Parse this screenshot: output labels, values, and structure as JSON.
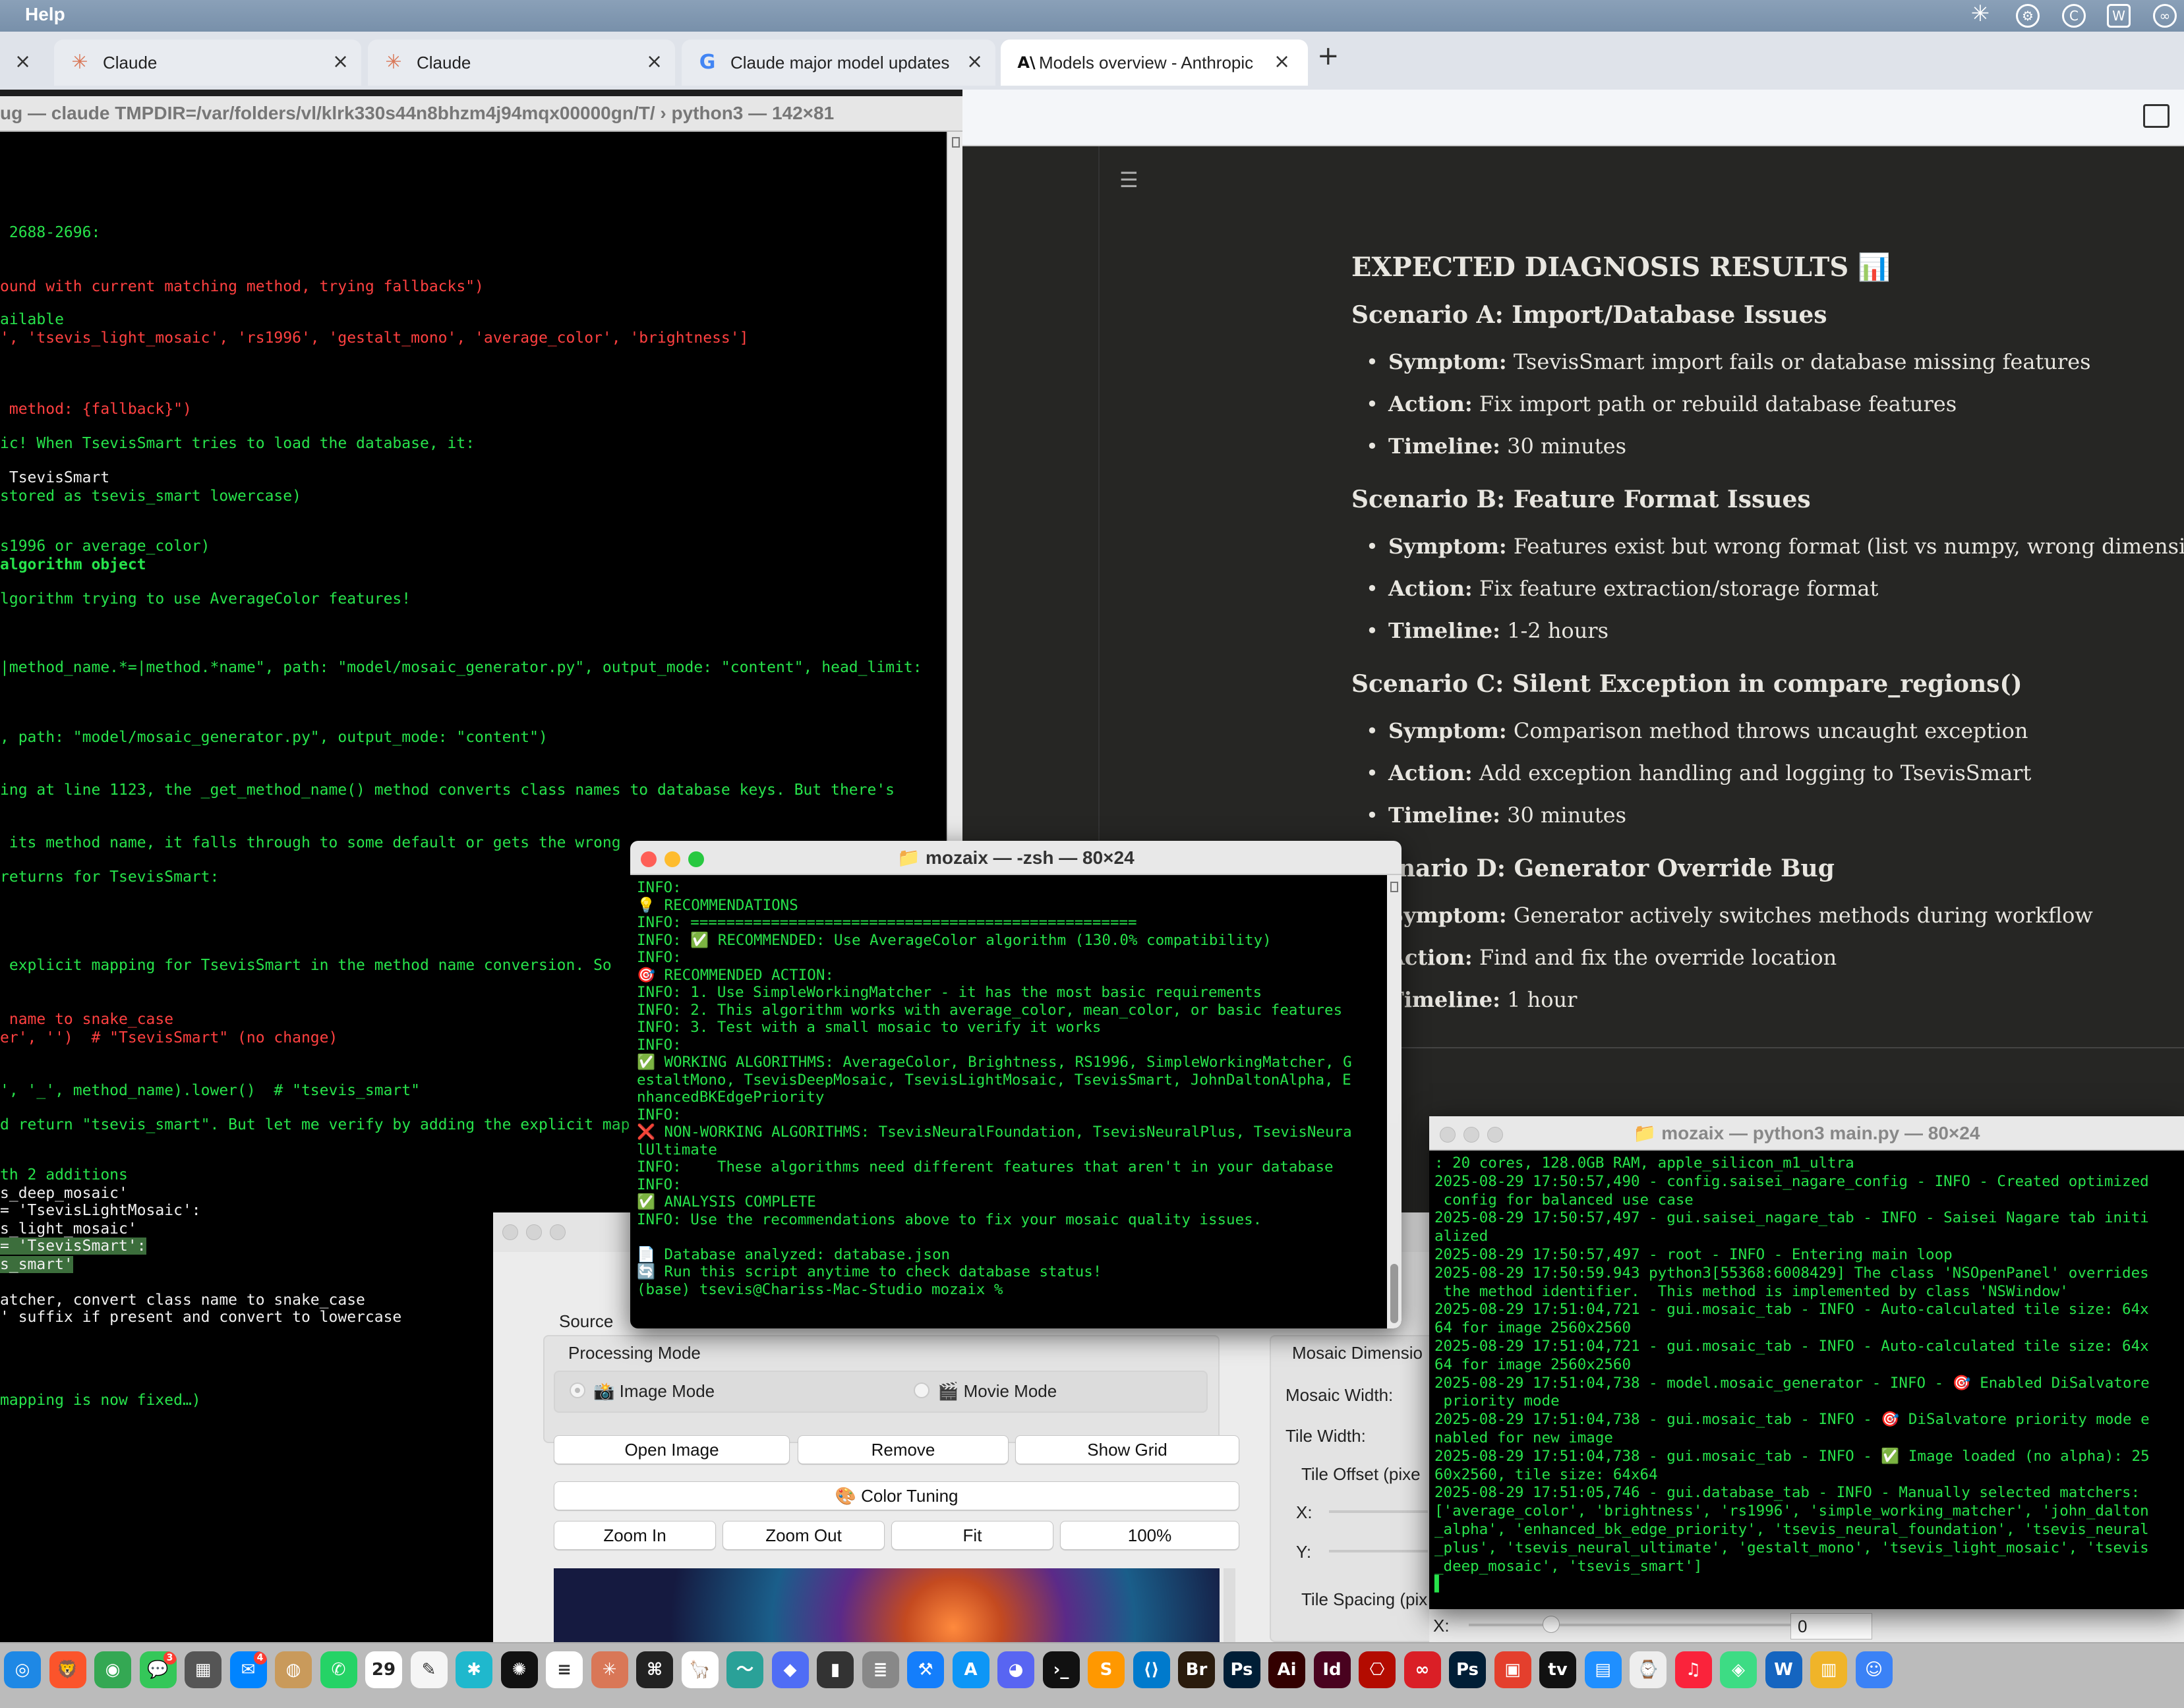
{
  "menubar": {
    "menu": "Help",
    "status_icons": [
      "claude-status-icon",
      "chatgpt-status-icon",
      "sync-status-icon",
      "w-status-icon",
      "creative-cloud-icon"
    ]
  },
  "browser": {
    "tabs": [
      {
        "label": "Claude",
        "icon": "claude-favicon"
      },
      {
        "label": "Claude",
        "icon": "claude-favicon"
      },
      {
        "label": "Claude major model updates",
        "icon": "google-favicon"
      },
      {
        "label": "Models overview - Anthropic",
        "icon": "anthropic-favicon"
      }
    ],
    "new_tab": "+",
    "close_glyph": "×"
  },
  "doc": {
    "heading": "EXPECTED DIAGNOSIS RESULTS 📊",
    "scenarios": [
      {
        "title": "Scenario A: Import/Database Issues",
        "items": [
          {
            "label": "Symptom:",
            "text": " TsevisSmart import fails or database missing features"
          },
          {
            "label": "Action:",
            "text": " Fix import path or rebuild database features"
          },
          {
            "label": "Timeline:",
            "text": " 30 minutes"
          }
        ]
      },
      {
        "title": "Scenario B: Feature Format Issues",
        "items": [
          {
            "label": "Symptom:",
            "text": " Features exist but wrong format (list vs numpy, wrong dimensions)"
          },
          {
            "label": "Action:",
            "text": " Fix feature extraction/storage format"
          },
          {
            "label": "Timeline:",
            "text": " 1-2 hours"
          }
        ]
      },
      {
        "title": "Scenario C: Silent Exception in compare_regions()",
        "items": [
          {
            "label": "Symptom:",
            "text": " Comparison method throws uncaught exception"
          },
          {
            "label": "Action:",
            "text": " Add exception handling and logging to TsevisSmart"
          },
          {
            "label": "Timeline:",
            "text": " 30 minutes"
          }
        ]
      },
      {
        "title": "Scenario D: Generator Override Bug",
        "items": [
          {
            "label": "Symptom:",
            "text": " Generator actively switches methods during workflow"
          },
          {
            "label": "Action:",
            "text": " Find and fix the override location"
          },
          {
            "label": "Timeline:",
            "text": " 1 hour"
          }
        ]
      }
    ]
  },
  "term_main": {
    "title": "ug — claude TMPDIR=/var/folders/vl/klrk330s44n8bhzm4j94mqx00000gn/T/ › python3 — 142×81",
    "lines": [
      {
        "text": " 2688-2696:",
        "color": "green"
      },
      {
        "text": "ound with current matching method, trying fallbacks\")",
        "color": "red"
      },
      {
        "text": "ailable",
        "color": "green"
      },
      {
        "text": "', 'tsevis_light_mosaic', 'rs1996', 'gestalt_mono', 'average_color', 'brightness']",
        "color": "red"
      },
      {
        "text": " method: {fallback}\")",
        "color": "red"
      },
      {
        "text": "ic! When TsevisSmart tries to load the database, it:",
        "color": "green",
        "bold_prefix": true
      },
      {
        "text": " TsevisSmart",
        "color": "white"
      },
      {
        "text": "stored as tsevis_smart lowercase)",
        "color": "green"
      },
      {
        "text": "s1996 or average_color)",
        "color": "green"
      },
      {
        "text": "algorithm object",
        "color": "green",
        "bold": true
      },
      {
        "text": "lgorithm trying to use AverageColor features!",
        "color": "green"
      },
      {
        "text": "|method_name.*=|method.*name\", path: \"model/mosaic_generator.py\", output_mode: \"content\", head_limit:",
        "color": "green"
      },
      {
        "text": ", path: \"model/mosaic_generator.py\", output_mode: \"content\")",
        "color": "green"
      },
      {
        "text": "ing at line 1123, the _get_method_name() method converts class names to database keys. But there's",
        "color": "green"
      },
      {
        "text": " its method name, it falls through to some default or gets the wrong",
        "color": "green"
      },
      {
        "text": "returns for TsevisSmart:",
        "color": "green"
      },
      {
        "text": " explicit mapping for TsevisSmart in the method name conversion. So",
        "color": "green"
      },
      {
        "text": " name to snake_case",
        "color": "red"
      },
      {
        "text": "er', '')  # \"TsevisSmart\" (no change)",
        "color": "red"
      },
      {
        "text": "', '_', method_name).lower()  # \"tsevis_smart\"",
        "color": "green"
      },
      {
        "text": "d return \"tsevis_smart\". But let me verify by adding the explicit map",
        "color": "green"
      },
      {
        "text": "th 2 additions",
        "color": "green"
      },
      {
        "text": "s_deep_mosaic'",
        "color": "white"
      },
      {
        "text": "= 'TsevisLightMosaic':",
        "color": "white"
      },
      {
        "text": "s_light_mosaic'",
        "color": "white"
      },
      {
        "text": "= 'TsevisSmart':",
        "color": "white",
        "highlight": true
      },
      {
        "text": "s_smart'",
        "color": "white",
        "highlight": true
      },
      {
        "text": "atcher, convert class name to snake_case",
        "color": "white"
      },
      {
        "text": "' suffix if present and convert to lowercase",
        "color": "white"
      },
      {
        "text": "mapping is now fixed…)",
        "color": "green"
      }
    ]
  },
  "term_zsh": {
    "title": "📁 mozaix — -zsh — 80×24",
    "lines": [
      {
        "text": "INFO:",
        "color": "green"
      },
      {
        "text": "💡 RECOMMENDATIONS",
        "color": "green"
      },
      {
        "text": "INFO: ==================================================",
        "color": "green"
      },
      {
        "text": "INFO: ✅ RECOMMENDED: Use AverageColor algorithm (130.0% compatibility)",
        "color": "green"
      },
      {
        "text": "INFO:",
        "color": "green"
      },
      {
        "text": "🎯 RECOMMENDED ACTION:",
        "color": "green"
      },
      {
        "text": "INFO: 1. Use SimpleWorkingMatcher - it has the most basic requirements",
        "color": "green"
      },
      {
        "text": "INFO: 2. This algorithm works with average_color, mean_color, or basic features",
        "color": "green"
      },
      {
        "text": "INFO: 3. Test with a small mosaic to verify it works",
        "color": "green"
      },
      {
        "text": "INFO:",
        "color": "green"
      },
      {
        "text": "✅ WORKING ALGORITHMS: AverageColor, Brightness, RS1996, SimpleWorkingMatcher, G",
        "color": "green"
      },
      {
        "text": "estaltMono, TsevisDeepMosaic, TsevisLightMosaic, TsevisSmart, JohnDaltonAlpha, E",
        "color": "green"
      },
      {
        "text": "nhancedBKEdgePriority",
        "color": "green"
      },
      {
        "text": "INFO:",
        "color": "green"
      },
      {
        "text": "❌ NON-WORKING ALGORITHMS: TsevisNeuralFoundation, TsevisNeuralPlus, TsevisNeura",
        "color": "green"
      },
      {
        "text": "lUltimate",
        "color": "green"
      },
      {
        "text": "INFO:    These algorithms need different features that aren't in your database",
        "color": "green"
      },
      {
        "text": "INFO:",
        "color": "green"
      },
      {
        "text": "✅ ANALYSIS COMPLETE",
        "color": "green"
      },
      {
        "text": "INFO: Use the recommendations above to fix your mosaic quality issues.",
        "color": "green"
      },
      {
        "text": "",
        "color": "green"
      },
      {
        "text": "📄 Database analyzed: database.json",
        "color": "green"
      },
      {
        "text": "🔄 Run this script anytime to check database status!",
        "color": "green"
      },
      {
        "text": "(base) tsevis@Chariss-Mac-Studio mozaix %",
        "color": "green"
      }
    ]
  },
  "term_py": {
    "title": "📁 mozaix — python3 main.py — 80×24",
    "lines": [
      ": 20 cores, 128.0GB RAM, apple_silicon_m1_ultra",
      "2025-08-29 17:50:57,490 - config.saisei_nagare_config - INFO - Created optimized",
      " config for balanced use case",
      "2025-08-29 17:50:57,497 - gui.saisei_nagare_tab - INFO - Saisei Nagare tab initi",
      "alized",
      "2025-08-29 17:50:57,497 - root - INFO - Entering main loop",
      "2025-08-29 17:50:59.943 python3[55368:6008429] The class 'NSOpenPanel' overrides",
      " the method identifier.  This method is implemented by class 'NSWindow'",
      "2025-08-29 17:51:04,721 - gui.mosaic_tab - INFO - Auto-calculated tile size: 64x",
      "64 for image 2560x2560",
      "2025-08-29 17:51:04,721 - gui.mosaic_tab - INFO - Auto-calculated tile size: 64x",
      "64 for image 2560x2560",
      "2025-08-29 17:51:04,738 - model.mosaic_generator - INFO - 🎯 Enabled DiSalvatore",
      " priority mode",
      "2025-08-29 17:51:04,738 - gui.mosaic_tab - INFO - 🎯 DiSalvatore priority mode e",
      "nabled for new image",
      "2025-08-29 17:51:04,738 - gui.mosaic_tab - INFO - ✅ Image loaded (no alpha): 25",
      "60x2560, tile size: 64x64",
      "2025-08-29 17:51:05,746 - gui.database_tab - INFO - Manually selected matchers:",
      "['average_color', 'brightness', 'rs1996', 'simple_working_matcher', 'john_dalton",
      "_alpha', 'enhanced_bk_edge_priority', 'tsevis_neural_foundation', 'tsevis_neural",
      "_plus', 'tsevis_neural_ultimate', 'gestalt_mono', 'tsevis_light_mosaic', 'tsevis",
      "_deep_mosaic', 'tsevis_smart']",
      "▌"
    ]
  },
  "gui": {
    "source_tab": "Source",
    "processing_mode": "Processing Mode",
    "image_mode": "📸 Image Mode",
    "movie_mode": "🎬 Movie Mode",
    "buttons_row1": [
      "Open Image",
      "Remove",
      "Show Grid"
    ],
    "color_tuning": "🎨 Color Tuning",
    "buttons_row2": [
      "Zoom In",
      "Zoom Out",
      "Fit",
      "100%"
    ],
    "mosaic_dimensions": "Mosaic Dimensio",
    "mosaic_width": "Mosaic Width:",
    "tile_width": "Tile Width:",
    "tile_offset": "Tile Offset (pixe",
    "x_label": "X:",
    "y_label": "Y:",
    "tile_spacing": "Tile Spacing (pix",
    "spacing_value": "0"
  },
  "dock": {
    "badges": {
      "messages": "3",
      "messenger": "4"
    },
    "calendar_day": "29",
    "items": [
      "Safari",
      "Brave",
      "Chrome",
      "Messages",
      "Calculator",
      "Messenger",
      "Contacts",
      "WhatsApp",
      "Calendar",
      "TextEdit",
      "Perplexity",
      "ChatGPT",
      "Notion",
      "Claude",
      "Terminal-Alt",
      "Ollama",
      "Activity",
      "Cube",
      "Finder-Alt",
      "Database",
      "Xcode",
      "App Store",
      "Discord",
      "Terminal",
      "Sublime",
      "VS Code",
      "Br",
      "Ps",
      "Ai",
      "Id",
      "Acrobat",
      "Creative Cloud",
      "Ps",
      "Office",
      "Apple TV",
      "Preview",
      "Clock",
      "Music",
      "Android",
      "W",
      "Notes",
      "Avatar"
    ]
  }
}
